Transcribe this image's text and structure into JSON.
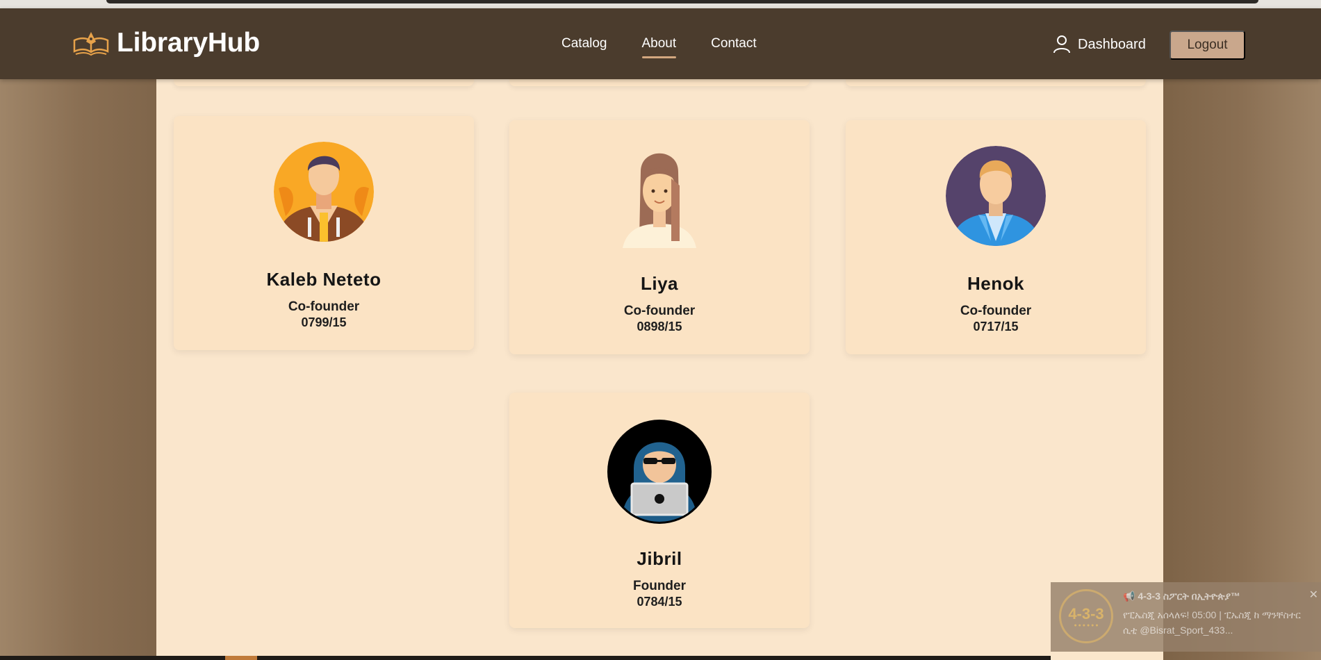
{
  "brand": {
    "name": "LibraryHub",
    "icon": "book-pen-icon"
  },
  "nav": {
    "links": [
      {
        "label": "Catalog",
        "active": false
      },
      {
        "label": "About",
        "active": true
      },
      {
        "label": "Contact",
        "active": false
      }
    ],
    "dashboard_label": "Dashboard",
    "dashboard_icon": "user-icon",
    "logout_label": "Logout"
  },
  "team": [
    {
      "name": "Kaleb Neteto",
      "role": "Co-founder",
      "id": "0799/15",
      "avatar": "man-hoodie-avatar"
    },
    {
      "name": "Liya",
      "role": "Co-founder",
      "id": "0898/15",
      "avatar": "woman-long-hair-avatar"
    },
    {
      "name": "Henok",
      "role": "Co-founder",
      "id": "0717/15",
      "avatar": "man-blazer-avatar"
    },
    {
      "name": "Jibril",
      "role": "Founder",
      "id": "0784/15",
      "avatar": "hacker-laptop-avatar"
    }
  ],
  "notification": {
    "logo_text": "4-3-3",
    "title": "📢 4-3-3 ስፖርት በኢትዮጵያ™",
    "body": "የፒኤስጂ አሰላለፍ! 05:00 | ፒኤስጂ ከ ማንቸስተር ሲቲ @Bisrat_Sport_433...",
    "close_label": "✕"
  },
  "colors": {
    "navbar": "#4b3c2d",
    "content_bg": "#fae6cc",
    "card_bg": "#fbe3c4",
    "accent": "#d3a77f",
    "logout_bg": "#c9a78c"
  }
}
